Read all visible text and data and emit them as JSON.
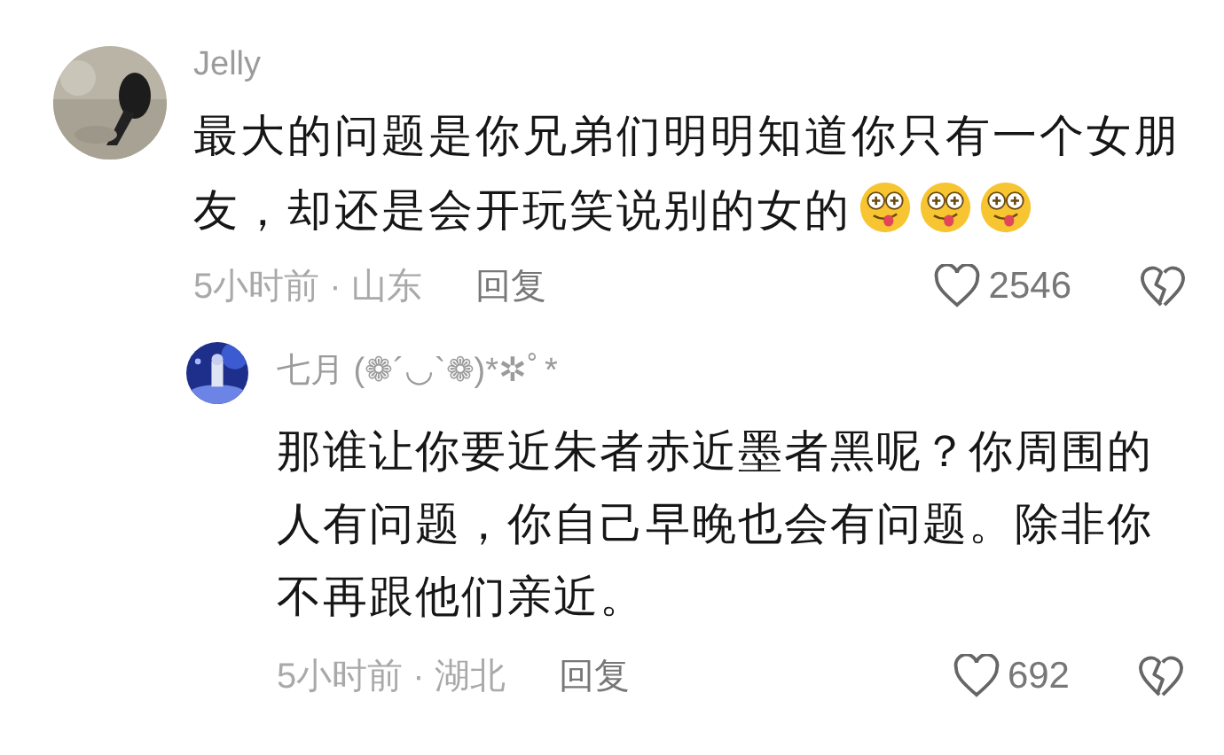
{
  "comments": [
    {
      "author": "Jelly",
      "text": "最大的问题是你兄弟们明明知道你只有一个女朋友，却还是会开玩笑说别的女的",
      "emojis": [
        {
          "kind": "drool"
        },
        {
          "kind": "drool"
        },
        {
          "kind": "drool"
        }
      ],
      "time": "5小时前 · 山东",
      "reply_label": "回复",
      "likes": "2546",
      "liked": false,
      "replies": [
        {
          "author": "七月 (❁´◡`❁)*✲ﾟ*",
          "text": "那谁让你要近朱者赤近墨者黑呢？你周围的人有问题，你自己早晚也会有问题。除非你不再跟他们亲近。",
          "time": "5小时前 · 湖北",
          "reply_label": "回复",
          "likes": "692",
          "liked": false
        }
      ]
    }
  ]
}
